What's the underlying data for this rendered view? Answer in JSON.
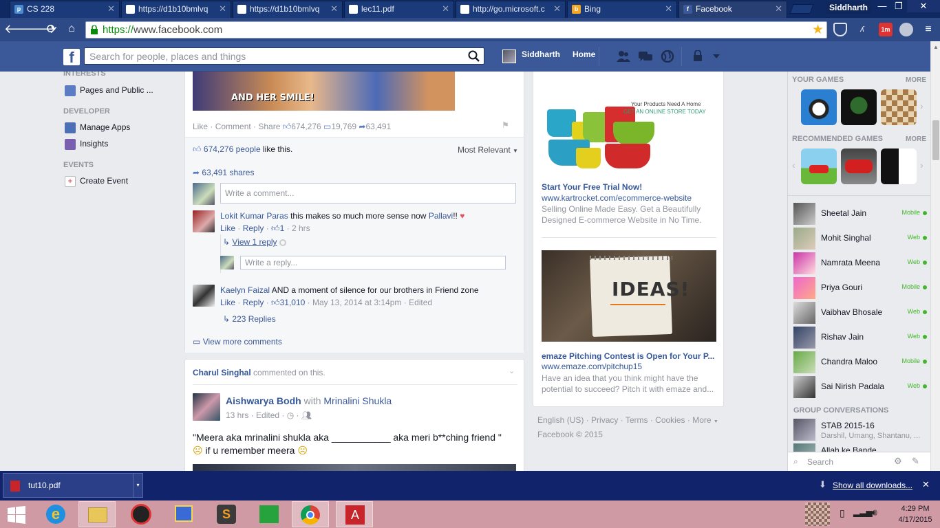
{
  "browser": {
    "tabs": [
      {
        "label": "CS 228",
        "favicon": "piazza-icon"
      },
      {
        "label": "https://d1b10bmlvq",
        "favicon": "document-icon"
      },
      {
        "label": "https://d1b10bmlvq",
        "favicon": "document-icon"
      },
      {
        "label": "lec11.pdf",
        "favicon": "document-icon"
      },
      {
        "label": "http://go.microsoft.c",
        "favicon": "document-icon"
      },
      {
        "label": "Bing",
        "favicon": "bing-icon"
      },
      {
        "label": "Facebook",
        "favicon": "facebook-icon"
      }
    ],
    "profile_name": "Siddharth",
    "url_scheme": "https://",
    "url_host": "www.facebook.com"
  },
  "fb": {
    "search_placeholder": "Search for people, places and things",
    "user_name": "Siddharth",
    "home_label": "Home"
  },
  "left_nav": {
    "interests_heading": "INTERESTS",
    "pages_label": "Pages and Public ...",
    "developer_heading": "DEVELOPER",
    "manage_apps": "Manage Apps",
    "insights": "Insights",
    "events_heading": "EVENTS",
    "create_event": "Create Event"
  },
  "post": {
    "image_caption": "AND HER SMILE!",
    "action_like": "Like",
    "action_comment": "Comment",
    "action_share": "Share",
    "likes_count": "674,276",
    "comments_count": "19,769",
    "shares_count": "63,491",
    "likes_summary_count": "674,276 people",
    "likes_summary_text": "like this.",
    "most_relevant": "Most Relevant",
    "shares_summary": "63,491 shares",
    "comment_placeholder": "Write a comment...",
    "comments": [
      {
        "author": "Lokit Kumar Paras",
        "text": "this makes so much more sense now",
        "mention": "Pallavi",
        "suffix": "!!",
        "like": "Like",
        "reply": "Reply",
        "likes": "1",
        "time": "2 hrs",
        "view_reply": "View 1 reply",
        "reply_placeholder": "Write a reply..."
      },
      {
        "author": "Kaelyn Faizal",
        "text": "AND a moment of silence for our brothers in Friend zone",
        "like": "Like",
        "reply": "Reply",
        "likes": "31,010",
        "time": "May 13, 2014 at 3:14pm",
        "edited": "Edited",
        "replies": "223 Replies"
      }
    ],
    "view_more_comments": "View more comments"
  },
  "post2": {
    "commenter": "Charul Singhal",
    "commented_text": "commented on this.",
    "author": "Aishwarya Bodh",
    "with_text": "with",
    "with_name": "Mrinalini Shukla",
    "time": "13 hrs",
    "edited": "Edited",
    "text_line1": "\"Meera aka mrinalini shukla aka ___________ aka meri b**ching friend \"",
    "text_line2": "if u remember meera"
  },
  "ads": [
    {
      "image_tagline1": "Your Products Need A Home",
      "image_tagline2": "GET AN ONLINE STORE TODAY",
      "title": "Start Your Free Trial Now!",
      "url": "www.kartrocket.com/ecommerce-website",
      "text_line1": "Selling Online Made Easy. Get a Beautifully",
      "text_line2": "Designed E-commerce Website in No Time."
    },
    {
      "image_text": "IDEAS!",
      "title": "emaze Pitching Contest is Open for Your P...",
      "url": "www.emaze.com/pitchup15",
      "text_line1": "Have an idea that you think might have the",
      "text_line2": "potential to succeed? Pitch it with emaze and..."
    }
  ],
  "footer": {
    "language": "English (US)",
    "privacy": "Privacy",
    "terms": "Terms",
    "cookies": "Cookies",
    "more": "More",
    "copyright": "Facebook © 2015"
  },
  "right_sidebar": {
    "your_games": "YOUR GAMES",
    "more1": "MORE",
    "recommended_games": "RECOMMENDED GAMES",
    "more2": "MORE",
    "friends": [
      {
        "name": "Sheetal Jain",
        "status": "Mobile"
      },
      {
        "name": "Mohit Singhal",
        "status": "Web"
      },
      {
        "name": "Namrata Meena",
        "status": "Web"
      },
      {
        "name": "Priya Gouri",
        "status": "Mobile"
      },
      {
        "name": "Vaibhav Bhosale",
        "status": "Web"
      },
      {
        "name": "Rishav Jain",
        "status": "Web"
      },
      {
        "name": "Chandra Maloo",
        "status": "Mobile"
      },
      {
        "name": "Sai Nirish Padala",
        "status": "Web"
      }
    ],
    "group_heading": "GROUP CONVERSATIONS",
    "groups": [
      {
        "name": "STAB 2015-16",
        "members": "Darshil, Umang, Shantanu, ..."
      },
      {
        "name": "Allah ke Bande",
        "members": ""
      }
    ],
    "search_placeholder": "Search"
  },
  "downloads": {
    "file": "tut10.pdf",
    "show_all": "Show all downloads..."
  },
  "taskbar": {
    "time": "4:29 PM",
    "date": "4/17/2015"
  },
  "colors": {
    "fb_blue": "#3b5998",
    "link": "#365899",
    "online_green": "#42b72a",
    "taskbar": "#cf9aa3"
  }
}
